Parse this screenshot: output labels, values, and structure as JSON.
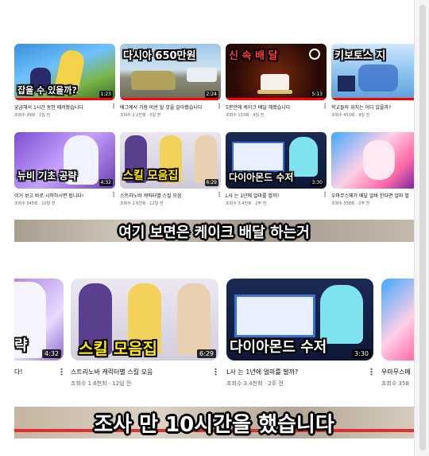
{
  "row1": [
    {
      "overlay": "잡을 수 있을까?",
      "duration": "1:23",
      "title": "궁금해서 1시간 동안 때려봤습니다",
      "meta": "조회수 29회 · 1일 전",
      "progress": 1.0
    },
    {
      "overlay": "다시아 650만원",
      "duration": "2:24",
      "title": "배그에서 가장 비싼 탈 것을 알아봤습니다",
      "meta": "조회수 2.2천회 · 3일 전",
      "progress": 1.0
    },
    {
      "overlay": "신 속 배 달",
      "duration": "5:13",
      "title": "5분만에 케이크 배달 해봤습니다",
      "meta": "조회수 133회 · 4일 전",
      "progress": 1.0
    },
    {
      "overlay": "키보토스 지",
      "duration": "",
      "title": "학교들의 위치는 어디 있을까?",
      "meta": "조회수 453회 · 9일 전",
      "progress": 1.0
    }
  ],
  "row2": [
    {
      "overlay": "뉴비 기초 공략",
      "duration": "4:32",
      "title": "이거 보고 바로 시작하시면 됩니다!",
      "meta": "조회수 345회 · 10일 전",
      "progress": 0.0
    },
    {
      "overlay": "스킬 모음집",
      "duration": "6:29",
      "title": "스트리노바 캐릭터별 스킬 모음",
      "meta": "조회수 1.6천회 · 12일 전",
      "progress": 0.0
    },
    {
      "overlay": "다이아몬드 수저",
      "duration": "3:30",
      "title": "L사 는 1년에 얼마를 벌까?",
      "meta": "조회수 3.4천회 · 2주 전",
      "progress": 0.0
    },
    {
      "overlay": "",
      "duration": "",
      "title": "우마무스메가 배달 알바 한다면 얼마 벌",
      "meta": "조회수 358회 · 2주 전",
      "progress": 0.0
    }
  ],
  "subtitle1": "여기 보면은 케이크 배달 하는거",
  "row3": [
    {
      "overlay": "략",
      "duration": "4:32",
      "title": "다!",
      "meta": ""
    },
    {
      "overlay": "스킬 모음집",
      "duration": "6:29",
      "title": "스트리노바 캐릭터별 스킬 모음",
      "meta": "조회수 1.6천회 · 12일 전"
    },
    {
      "overlay": "다이아몬드 수저",
      "duration": "3:30",
      "title": "L사 는 1년에 얼마를 벌까?",
      "meta": "조회수 3.4천회 · 2주 전"
    },
    {
      "overlay": "",
      "duration": "",
      "title": "우마무스메",
      "meta": "조회수 358"
    }
  ],
  "subtitle2": "조사 만 10시간을 했습니다",
  "icons": {
    "more": "more-vert-icon"
  },
  "colors": {
    "progress": "#ff0000",
    "title": "#0f0f0f",
    "meta": "#606060"
  }
}
